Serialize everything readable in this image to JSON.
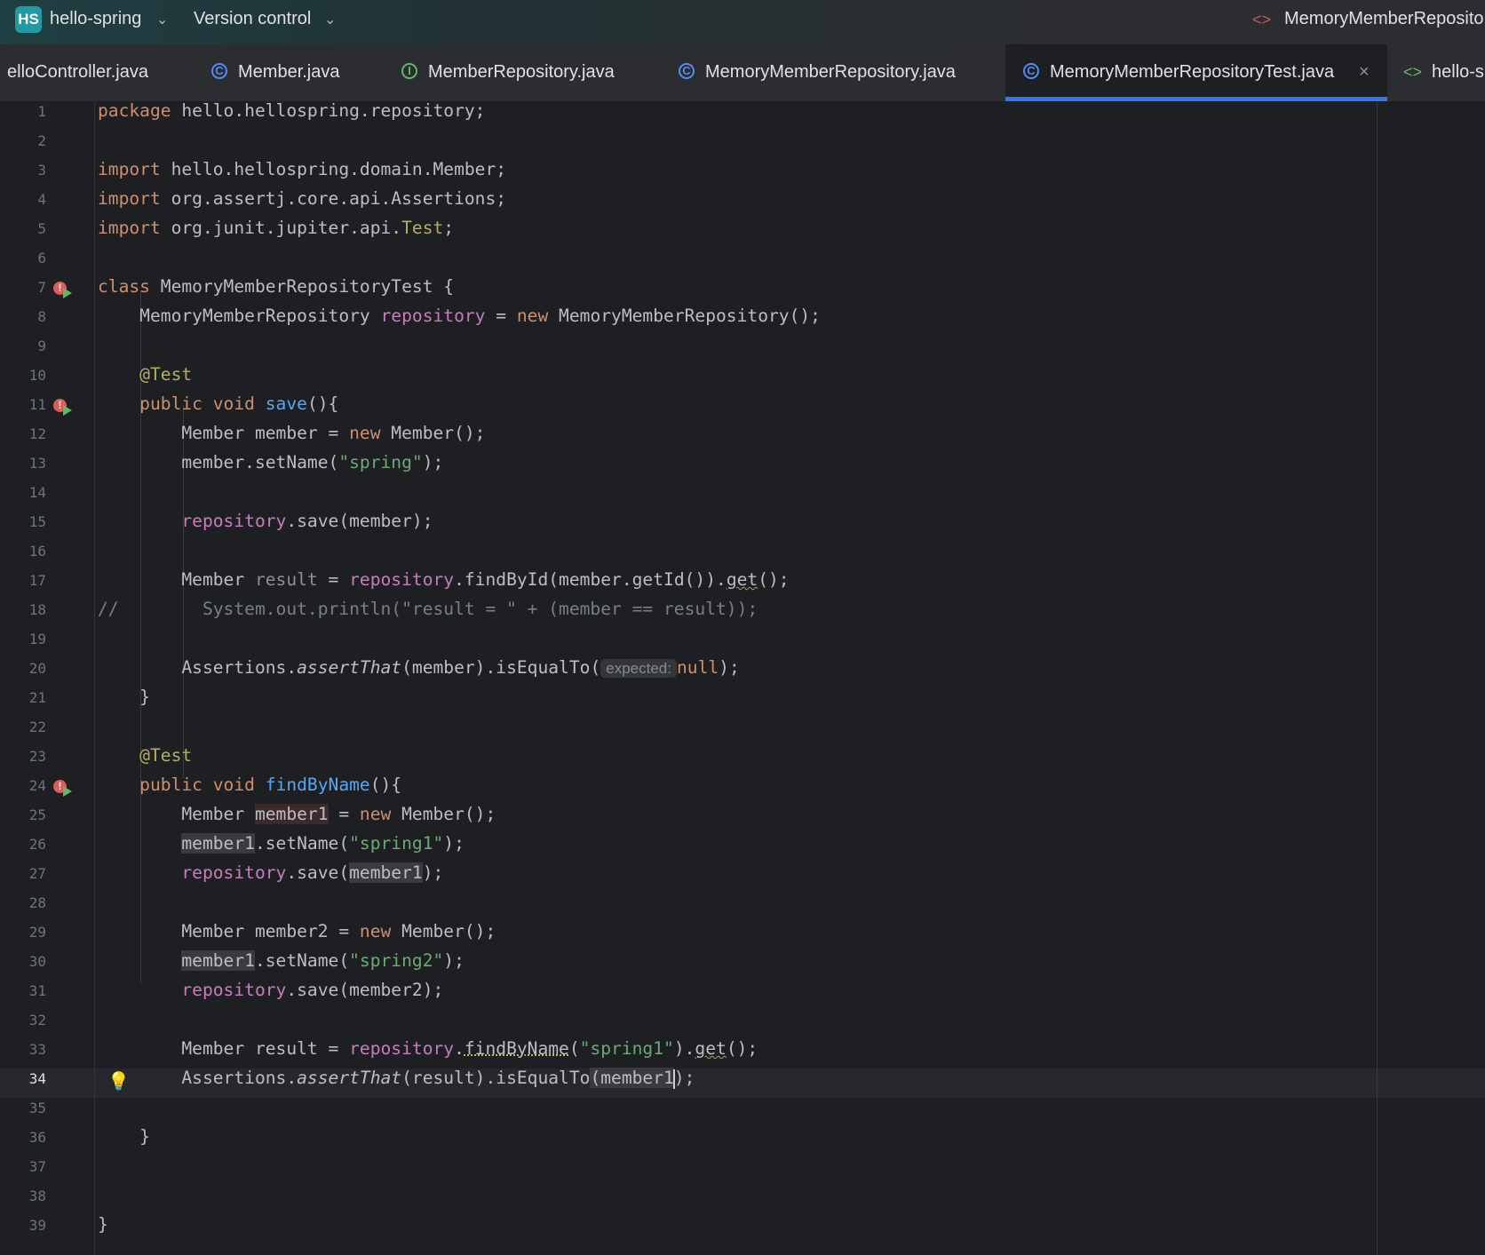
{
  "topbar": {
    "project_badge": "HS",
    "project_name": "hello-spring",
    "vcs_label": "Version control",
    "run_config": "MemoryMemberReposito"
  },
  "tabs": [
    {
      "label": "elloController.java",
      "icon": "none"
    },
    {
      "label": "Member.java",
      "icon": "class-icon"
    },
    {
      "label": "MemberRepository.java",
      "icon": "interface-icon"
    },
    {
      "label": "MemoryMemberRepository.java",
      "icon": "class-icon"
    },
    {
      "label": "MemoryMemberRepositoryTest.java",
      "icon": "class-icon",
      "active": true
    },
    {
      "label": "hello-s",
      "icon": "html-icon"
    }
  ],
  "icons": {
    "class_glyph": "C",
    "interface_glyph": "I",
    "html_glyph": "<>",
    "close_glyph": "×",
    "bulb_glyph": "💡",
    "error_glyph": "!"
  },
  "editor": {
    "current_line": 34,
    "inlay_hint": "expected:",
    "line_numbers": [
      "1",
      "2",
      "3",
      "4",
      "5",
      "6",
      "7",
      "8",
      "9",
      "10",
      "11",
      "12",
      "13",
      "14",
      "15",
      "16",
      "17",
      "18",
      "19",
      "20",
      "21",
      "22",
      "23",
      "24",
      "25",
      "26",
      "27",
      "28",
      "29",
      "30",
      "31",
      "32",
      "33",
      "34",
      "35",
      "36",
      "37",
      "38",
      "39"
    ],
    "code": {
      "l1_kw": "package",
      "l1_rest": " hello.hellospring.repository;",
      "l3_kw": "import",
      "l3_rest": " hello.hellospring.domain.Member;",
      "l4_kw": "import",
      "l4_rest": " org.assertj.core.api.Assertions;",
      "l5_kw": "import",
      "l5_rest": " org.junit.jupiter.api.",
      "l5_ann": "Test",
      "l5_end": ";",
      "l7_kw": "class",
      "l7_rest": " MemoryMemberRepositoryTest {",
      "l8_a": "    MemoryMemberRepository ",
      "l8_fld": "repository",
      "l8_b": " = ",
      "l8_kw": "new",
      "l8_c": " MemoryMemberRepository();",
      "l10_ann": "    @Test",
      "l11_kw": "    public void ",
      "l11_fn": "save",
      "l11_rest": "(){",
      "l12_a": "        Member member = ",
      "l12_kw": "new",
      "l12_b": " Member();",
      "l13_a": "        member.setName(",
      "l13_str": "\"spring\"",
      "l13_b": ");",
      "l15_fld": "repository",
      "l15_rest": ".save(member);",
      "l17_a": "        Member ",
      "l17_grey": "result",
      "l17_b": " = ",
      "l17_fld": "repository",
      "l17_c": ".findById(member.getId()).",
      "l17_get": "get",
      "l17_d": "();",
      "l18": "//        System.out.println(\"result = \" + (member == result));",
      "l20_a": "        Assertions.",
      "l20_it": "assertThat",
      "l20_b": "(member).isEqualTo(",
      "l20_kw": "null",
      "l20_c": ");",
      "l21": "    }",
      "l23_ann": "    @Test",
      "l24_kw": "    public void ",
      "l24_fn": "findByName",
      "l24_rest": "(){",
      "l25_a": "        Member ",
      "l25_hl": "member1",
      "l25_b": " = ",
      "l25_kw": "new",
      "l25_c": " Member();",
      "l26_hl": "member1",
      "l26_a": ".setName(",
      "l26_str": "\"spring1\"",
      "l26_b": ");",
      "l27_fld": "repository",
      "l27_a": ".save(",
      "l27_hl": "member1",
      "l27_b": ");",
      "l29_a": "        Member member2 = ",
      "l29_kw": "new",
      "l29_b": " Member();",
      "l30_hl": "member1",
      "l30_a": ".setName(",
      "l30_str": "\"spring2\"",
      "l30_b": ");",
      "l31_fld": "repository",
      "l31_a": ".save(member2);",
      "l33_a": "        Member result = ",
      "l33_fld": "repository",
      "l33_b": ".",
      "l33_fn": "findByName",
      "l33_c": "(",
      "l33_str": "\"spring1\"",
      "l33_d": ").",
      "l33_get": "get",
      "l33_e": "();",
      "l34_a": "        Assertions.",
      "l34_it": "assertThat",
      "l34_b": "(result).isEqualTo",
      "l34_hl": "(member1",
      "l34_c": ");",
      "l36": "    }",
      "l39": "}"
    }
  },
  "colors": {
    "accent": "#3574f0",
    "keyword": "#cf8e6d",
    "string": "#6aab73",
    "field": "#c77dbb",
    "function": "#56a8f5",
    "annotation": "#b3ae60"
  }
}
